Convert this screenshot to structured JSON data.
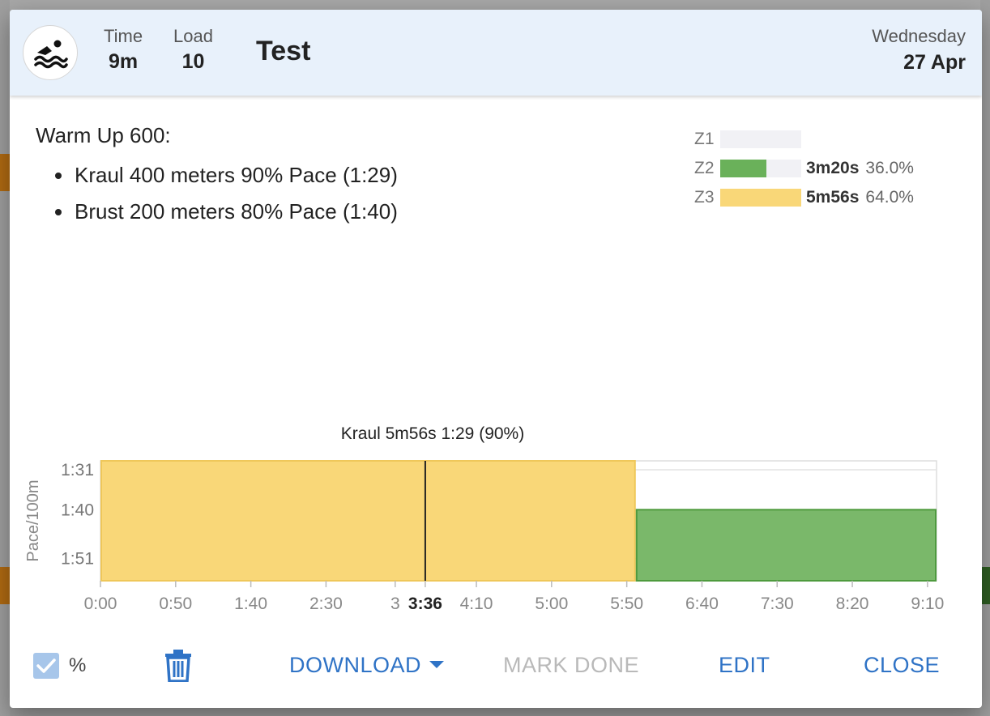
{
  "header": {
    "time_label": "Time",
    "time_value": "9m",
    "load_label": "Load",
    "load_value": "10",
    "title": "Test",
    "weekday": "Wednesday",
    "date": "27 Apr"
  },
  "description": {
    "heading": "Warm Up 600:",
    "items": [
      "Kraul 400 meters 90% Pace (1:29)",
      "Brust 200 meters 80% Pace (1:40)"
    ]
  },
  "zones": [
    {
      "label": "Z1",
      "duration": "",
      "percent_text": "",
      "fraction": 0,
      "color": "#f1f1f5"
    },
    {
      "label": "Z2",
      "duration": "3m20s",
      "percent_text": "36.0%",
      "fraction": 0.57,
      "color": "#6ab15a"
    },
    {
      "label": "Z3",
      "duration": "5m56s",
      "percent_text": "64.0%",
      "fraction": 1.0,
      "color": "#f9d778"
    }
  ],
  "chart_data": {
    "type": "area",
    "title": "Kraul 5m56s 1:29 (90%)",
    "ylabel": "Pace/100m",
    "y_ticks": [
      "1:31",
      "1:40",
      "1:51"
    ],
    "x_ticks": [
      "0:00",
      "0:50",
      "1:40",
      "2:30",
      "3",
      "3:36",
      "4:10",
      "5:00",
      "5:50",
      "6:40",
      "7:30",
      "8:20",
      "9:10"
    ],
    "x_tick_seconds": [
      0,
      50,
      100,
      150,
      196,
      216,
      250,
      300,
      350,
      400,
      450,
      500,
      550
    ],
    "highlight_tick": "3:36",
    "xlim_seconds": [
      0,
      556
    ],
    "cursor_seconds": 216,
    "segments": [
      {
        "name": "Kraul",
        "start_seconds": 0,
        "end_seconds": 356,
        "pace": "1:29",
        "color": "#f9d778",
        "stroke": "#efc75a"
      },
      {
        "name": "Brust",
        "start_seconds": 356,
        "end_seconds": 556,
        "pace": "1:40",
        "color": "#7ab86a",
        "stroke": "#4e9a3e"
      }
    ]
  },
  "footer": {
    "percent_label": "%",
    "download_label": "DOWNLOAD",
    "mark_done_label": "MARK DONE",
    "edit_label": "EDIT",
    "close_label": "CLOSE"
  }
}
